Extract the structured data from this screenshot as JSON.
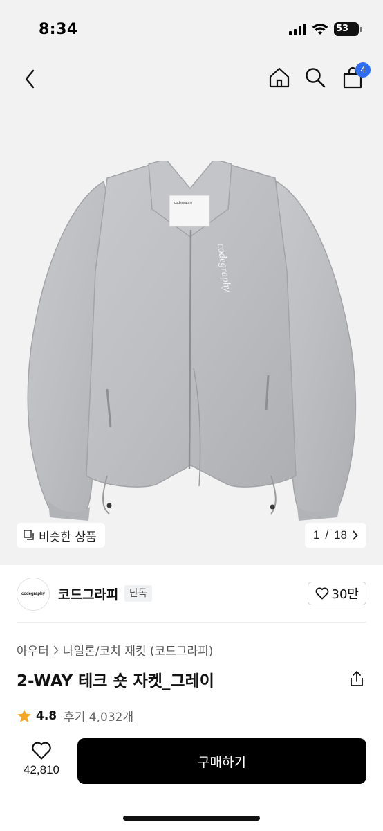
{
  "status": {
    "time": "8:34",
    "battery": "53"
  },
  "nav": {
    "cart_count": "4"
  },
  "gallery": {
    "similar_label": "비슷한 상품",
    "page_current": "1",
    "page_sep": "/",
    "page_total": "18",
    "garment_label": "codegraphy"
  },
  "brand": {
    "logo_text": "codegraphy",
    "name": "코드그라피",
    "tag": "단독",
    "likes": "30만"
  },
  "breadcrumb": [
    "아우터",
    "나일론/코치 재킷 (코드그라피)"
  ],
  "product": {
    "title": "2-WAY 테크 숏 자켓_그레이",
    "rating": "4.8",
    "reviews": "후기 4,032개"
  },
  "bottom": {
    "wish_count": "42,810",
    "buy_label": "구매하기"
  },
  "colors": {
    "accent_badge": "#2f6df0",
    "star": "#f5a623",
    "buy_button": "#000000"
  }
}
